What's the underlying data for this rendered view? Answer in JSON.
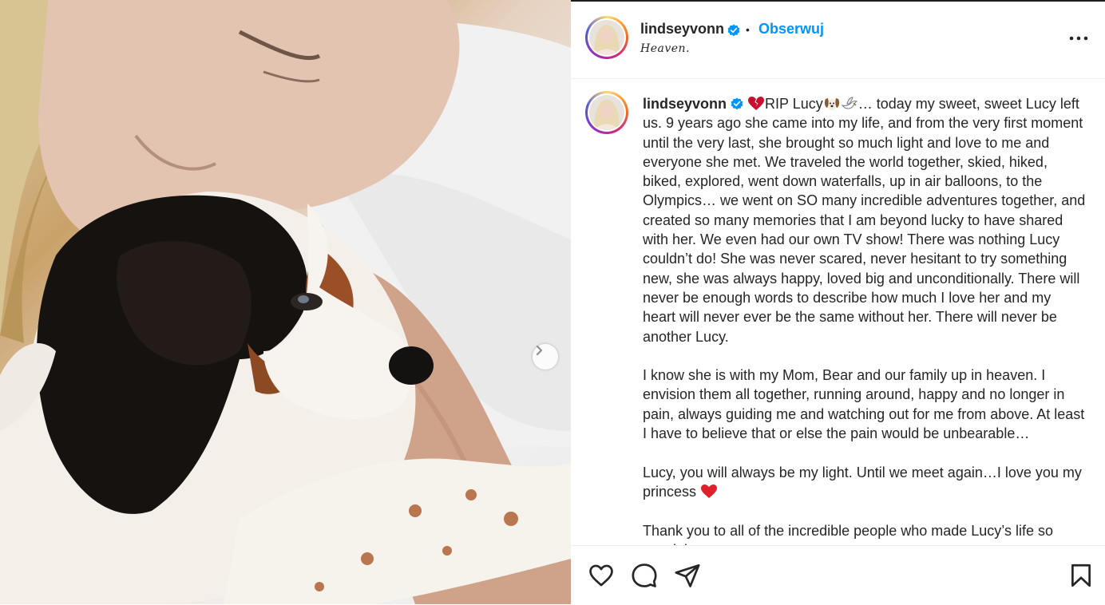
{
  "post": {
    "username": "lindseyvonn",
    "follow_label": "Obserwuj",
    "location": "Heaven.",
    "more_label": "More options",
    "image_alt": "Lindsey Vonn lying on a pillow with her Cavalier King Charles spaniel Lucy",
    "next_label": "Next"
  },
  "caption": {
    "username": "lindseyvonn",
    "intro": "RIP Lucy",
    "intro_rest": "… today my sweet, sweet Lucy left us. 9 years ago she came into my life, and from the very first moment until the very last, she brought so much light and love to me and everyone she met. We traveled the world together, skied, hiked, biked, explored, went down waterfalls, up in air balloons, to the Olympics… we went on SO many incredible adventures together, and created so many memories that I am beyond lucky to have shared with her. We even had our own TV show! There was nothing Lucy couldn’t do! She was never scared, never hesitant to try something new, she was always happy, loved big and unconditionally. There will never be enough words to describe how much I love her and my heart will never ever be the same without her. There will never be another Lucy.",
    "paragraph2": "I know she is with my Mom, Bear and our family up in heaven. I envision them all together, running around, happy and no longer in pain, always guiding me and watching out for me from above. At least I have to believe that or else the pain would be unbearable…",
    "paragraph3": "Lucy, you will always be my light. Until we meet again…I love you my princess",
    "paragraph4": "Thank you to all of the incredible people who made Lucy’s life so special"
  },
  "actions": {
    "like": "Like",
    "comment": "Comment",
    "share": "Share",
    "save": "Save"
  },
  "colors": {
    "follow": "#0095f6",
    "verified": "#0095f6",
    "heart": "#e0202a",
    "text": "#262626"
  },
  "icons": [
    "verified-badge-icon",
    "more-options-icon",
    "chevron-right-icon",
    "heart-icon",
    "comment-icon",
    "share-icon",
    "bookmark-icon",
    "broken-heart-emoji",
    "dog-emoji",
    "dove-emoji",
    "red-heart-emoji"
  ]
}
